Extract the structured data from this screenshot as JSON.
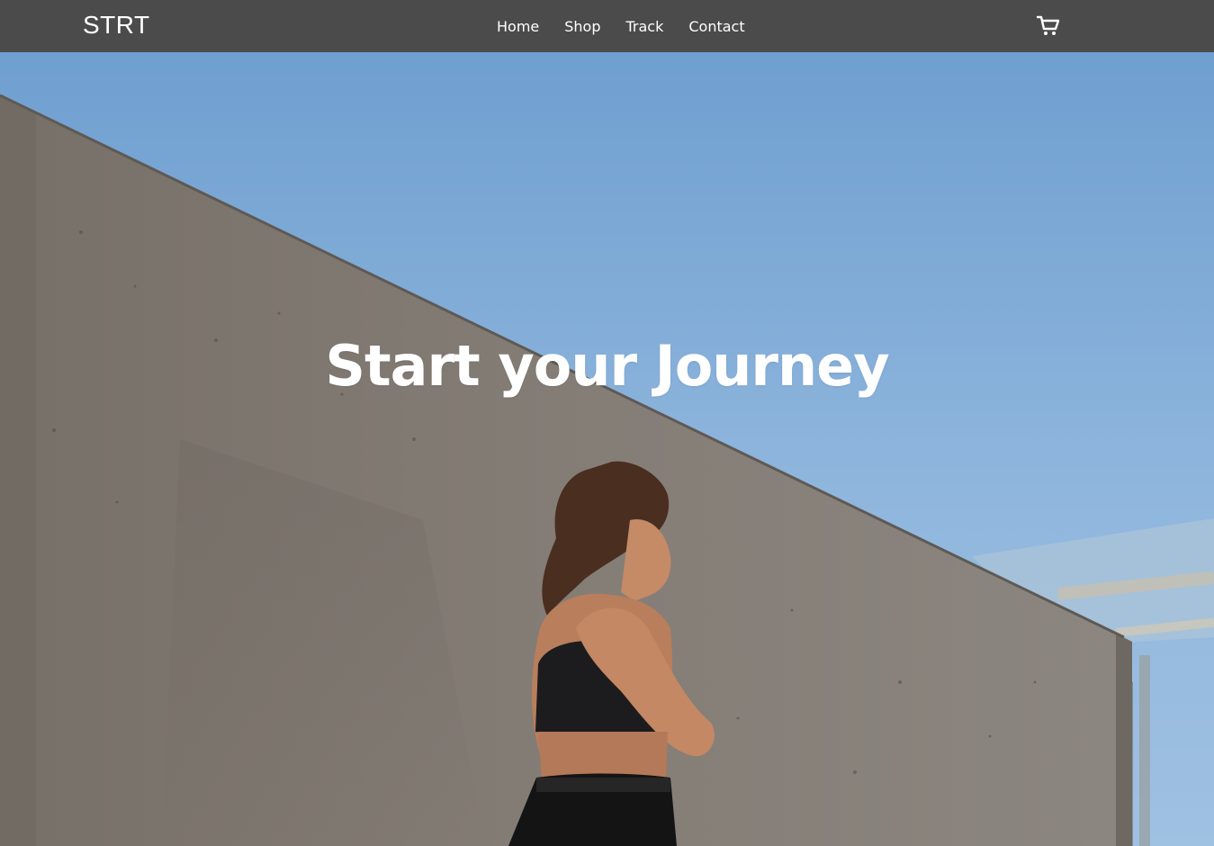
{
  "brand": {
    "name": "STRT"
  },
  "nav": {
    "items": [
      {
        "label": "Home"
      },
      {
        "label": "Shop"
      },
      {
        "label": "Track"
      },
      {
        "label": "Contact"
      }
    ],
    "cart_icon": "shopping-cart-icon"
  },
  "hero": {
    "headline": "Start your Journey",
    "image": "woman-running-by-concrete-wall-photo"
  },
  "colors": {
    "navbar": "#4b4b4b",
    "text": "#ffffff",
    "sky": "#8fb6dd",
    "wall": "#7f7a75"
  }
}
